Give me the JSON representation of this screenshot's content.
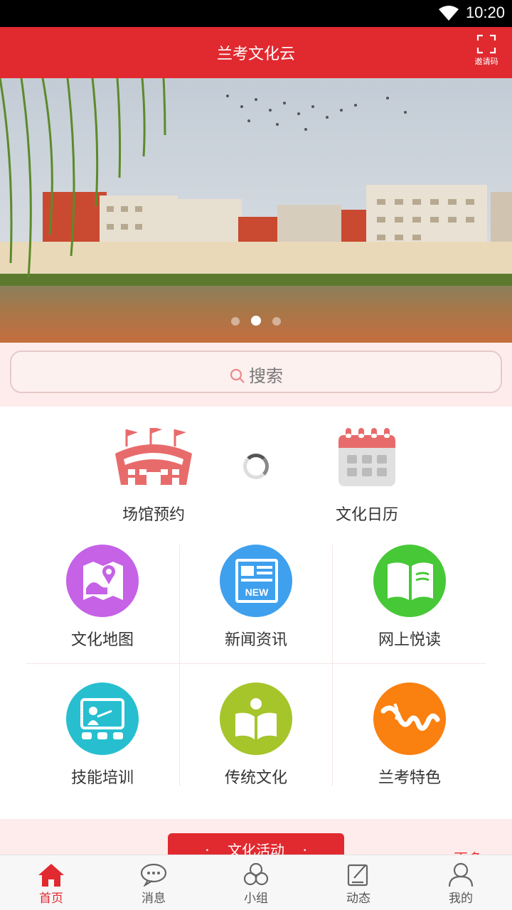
{
  "status_bar": {
    "time": "10:20"
  },
  "header": {
    "title": "兰考文化云",
    "invite_label": "邀请码"
  },
  "search": {
    "placeholder": "搜索"
  },
  "top_items": [
    {
      "label": "场馆预约",
      "icon": "stadium-icon"
    },
    {
      "label": "文化日历",
      "icon": "calendar-icon"
    }
  ],
  "grid_items": [
    {
      "label": "文化地图",
      "icon": "map-icon",
      "color": "#c562e6"
    },
    {
      "label": "新闻资讯",
      "icon": "news-icon",
      "color": "#3fa0ee"
    },
    {
      "label": "网上悦读",
      "icon": "book-icon",
      "color": "#47c837"
    },
    {
      "label": "技能培训",
      "icon": "teacher-icon",
      "color": "#27bfd0"
    },
    {
      "label": "传统文化",
      "icon": "reading-icon",
      "color": "#a5c52a"
    },
    {
      "label": "兰考特色",
      "icon": "calligraphy-icon",
      "color": "#fa8010"
    }
  ],
  "activities": {
    "title": "文化活动",
    "more": "更多"
  },
  "bottom_nav": [
    {
      "label": "首页",
      "icon": "home-icon",
      "active": true
    },
    {
      "label": "消息",
      "icon": "chat-icon",
      "active": false
    },
    {
      "label": "小组",
      "icon": "group-icon",
      "active": false
    },
    {
      "label": "动态",
      "icon": "edit-icon",
      "active": false
    },
    {
      "label": "我的",
      "icon": "user-icon",
      "active": false
    }
  ],
  "colors": {
    "brand": "#e02a30",
    "search_bg": "#fdeceb"
  }
}
